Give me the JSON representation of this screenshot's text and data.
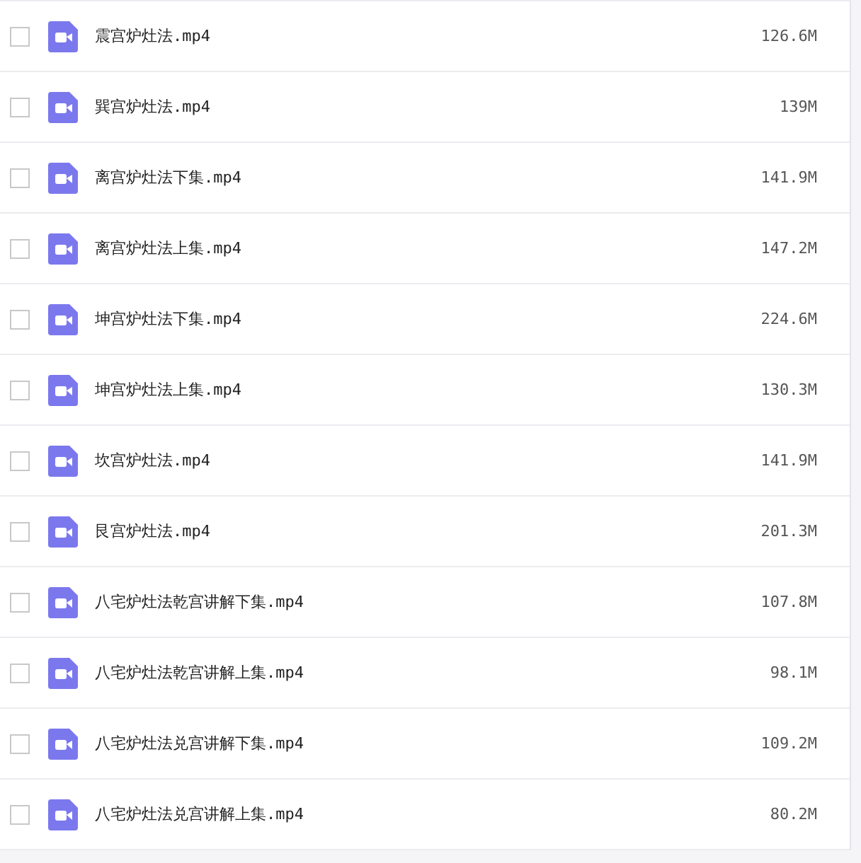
{
  "files": [
    {
      "name": "震宫炉灶法.mp4",
      "size": "126.6M",
      "checked": false
    },
    {
      "name": "巽宫炉灶法.mp4",
      "size": "139M",
      "checked": false
    },
    {
      "name": "离宫炉灶法下集.mp4",
      "size": "141.9M",
      "checked": false
    },
    {
      "name": "离宫炉灶法上集.mp4",
      "size": "147.2M",
      "checked": false
    },
    {
      "name": "坤宫炉灶法下集.mp4",
      "size": "224.6M",
      "checked": false
    },
    {
      "name": "坤宫炉灶法上集.mp4",
      "size": "130.3M",
      "checked": false
    },
    {
      "name": "坎宫炉灶法.mp4",
      "size": "141.9M",
      "checked": false
    },
    {
      "name": "艮宫炉灶法.mp4",
      "size": "201.3M",
      "checked": false
    },
    {
      "name": "八宅炉灶法乾宫讲解下集.mp4",
      "size": "107.8M",
      "checked": false
    },
    {
      "name": "八宅炉灶法乾宫讲解上集.mp4",
      "size": "98.1M",
      "checked": false
    },
    {
      "name": "八宅炉灶法兑宫讲解下集.mp4",
      "size": "109.2M",
      "checked": false
    },
    {
      "name": "八宅炉灶法兑宫讲解上集.mp4",
      "size": "80.2M",
      "checked": false
    }
  ]
}
